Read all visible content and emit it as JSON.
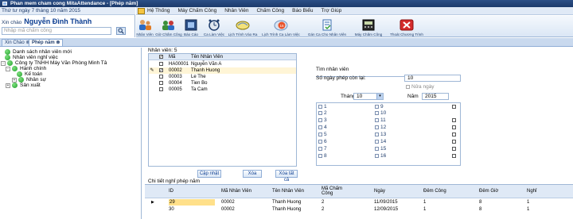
{
  "window": {
    "title": "Phan mem cham cong MitaAttendance - [Phép năm]"
  },
  "left": {
    "date_text": "Thứ tư ngày 7 tháng 10 năm 2015",
    "greeting": "Xin chào",
    "user_name": "Nguyễn Đình Thành",
    "search_placeholder": "Nhập mã chấm công"
  },
  "menu": [
    "Hệ Thống",
    "Máy Chấm Công",
    "Nhân Viên",
    "Chấm Công",
    "Báo Biểu",
    "Trợ Giúp"
  ],
  "toolbar": [
    {
      "label": "Nhân Viên",
      "icon": "users-icon"
    },
    {
      "label": "Giờ Chấm Công",
      "icon": "clock-icon"
    },
    {
      "label": "Báo Cáo",
      "icon": "report-icon"
    },
    {
      "label": "Ca Làm Việc",
      "icon": "shift-icon"
    },
    {
      "label": "Lịch Trình Vào Ra",
      "icon": "schedule-icon"
    },
    {
      "label": "Lịch Trình Ca Làm Việc",
      "icon": "calendar-icon"
    },
    {
      "label": "Gán Ca Cho Nhân Viên",
      "icon": "assign-icon"
    },
    {
      "label": "Máy Chấm Công",
      "icon": "machine-icon"
    },
    {
      "label": "Thoát Chương Trình",
      "icon": "exit-icon"
    }
  ],
  "calendar_day": "15",
  "tabs": [
    {
      "label": "Xin Chào",
      "active": false
    },
    {
      "label": "Phép năm",
      "active": true
    }
  ],
  "tree": {
    "n1": "Danh sách nhân viên mới",
    "n2": "Nhân viên nghỉ việc",
    "n3": "Công ty TNHH Máy Văn Phòng Minh Tâ",
    "n4": "Hành chính",
    "n5": "Kế toán",
    "n6": "Nhân sự",
    "n7": "Sản xuất"
  },
  "employees": {
    "count_label": "Nhân viên: 5",
    "headers": {
      "code": "Mã",
      "name": "Tên Nhân Viên"
    },
    "rows": [
      {
        "code": "HA00001",
        "name": "Nguyễn Văn A",
        "checked": false
      },
      {
        "code": "00002",
        "name": "Thanh Huong",
        "checked": true
      },
      {
        "code": "00003",
        "name": "Le The",
        "checked": false
      },
      {
        "code": "00004",
        "name": "Tien Bo",
        "checked": false
      },
      {
        "code": "00005",
        "name": "Ta Cam",
        "checked": false
      }
    ],
    "buttons": {
      "update": "Cập nhật",
      "delete": "Xóa",
      "delete_all": "Xóa tất cả"
    }
  },
  "form": {
    "search_label": "Tìm nhân viên",
    "remaining_label": "Số ngày phép còn lại:",
    "remaining_value": "10",
    "half_day": "Nửa ngày",
    "month_label": "Tháng",
    "month_value": "10",
    "year_label": "Năm",
    "year_value": "2015"
  },
  "days_col1": [
    "1",
    "2",
    "3",
    "4",
    "5",
    "6",
    "7",
    "8"
  ],
  "days_col2": [
    "9",
    "10",
    "11",
    "12",
    "13",
    "14",
    "15",
    "16"
  ],
  "detail": {
    "section_label": "Chi tiết nghỉ phép năm",
    "headers": [
      "ID",
      "Mã Nhân Viên",
      "Tên Nhân Viên",
      "Mã Chấm Công",
      "Ngày",
      "Đêm Công",
      "Đêm Giờ",
      "Nghỉ"
    ],
    "rows": [
      [
        "29",
        "00002",
        "Thanh Huong",
        "2",
        "11/09/2015",
        "1",
        "8",
        "1"
      ],
      [
        "30",
        "00002",
        "Thanh Huong",
        "2",
        "12/09/2015",
        "1",
        "8",
        "1"
      ]
    ]
  }
}
